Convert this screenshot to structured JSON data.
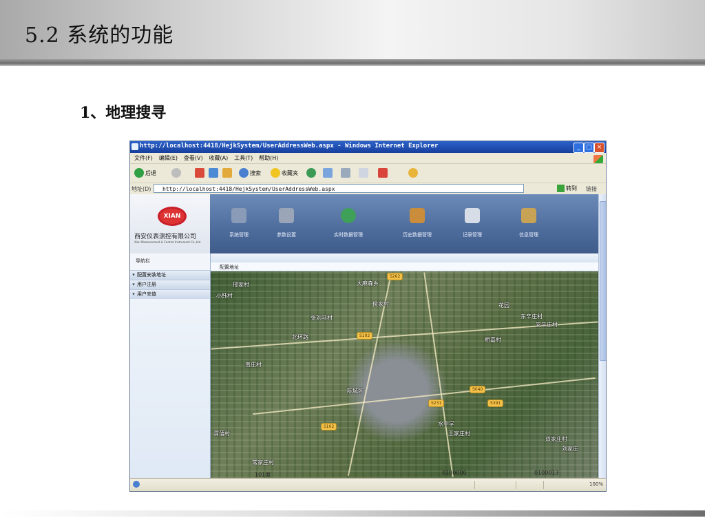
{
  "slide": {
    "title": "5.2   系统的功能",
    "subtitle": "1、地理搜寻"
  },
  "browser": {
    "window_title": "http://localhost:4418/HejkSystem/UserAddressWeb.aspx - Windows Internet Explorer",
    "menu": [
      "文件(F)",
      "编辑(E)",
      "查看(V)",
      "收藏(A)",
      "工具(T)",
      "帮助(H)"
    ],
    "toolbar": {
      "back": "后退",
      "search": "搜索",
      "favorites": "收藏夹"
    },
    "address_label": "地址(D)",
    "address_url": "http://localhost:4418/HejkSystem/UserAddressWeb.aspx",
    "go_label": "转到",
    "links_label": "链接"
  },
  "app": {
    "company_name": "西安仪表测控有限公司",
    "company_en": "Xian Measurement & Control Instrument Co.,Ltd",
    "logo_text": "XIAN",
    "nav": [
      {
        "label": "系统管理",
        "icon": "monitor-user-icon",
        "color": "#8a9bb8"
      },
      {
        "label": "参数设置",
        "icon": "settings-panel-icon",
        "color": "#9aa6b8"
      },
      {
        "label": "实时数据管理",
        "icon": "clock-icon",
        "color": "#3fa05a"
      },
      {
        "label": "历史数据管理",
        "icon": "notebook-pen-icon",
        "color": "#c98d3c"
      },
      {
        "label": "记录管理",
        "icon": "keys-icon",
        "color": "#d7dde6"
      },
      {
        "label": "信息管理",
        "icon": "toolbox-icon",
        "color": "#c8a255"
      }
    ],
    "sidebar_title": "导航栏",
    "sidebar_items": [
      "配置安装地址",
      "用户注册",
      "用户充值"
    ],
    "content_title": "配置地址",
    "map_labels": [
      "大麻森乡",
      "邢家村",
      "小韩村",
      "花园",
      "张刘马村",
      "北环路",
      "侯家村",
      "东辛庄村",
      "安辛庄村",
      "相嘉村",
      "陈城区",
      "南庄村",
      "水中学",
      "王家庄村",
      "双家庄村",
      "刘家庄",
      "渭蒲村",
      "常家庄村"
    ],
    "road_badges": [
      "S262",
      "S102",
      "S231",
      "S040",
      "S391",
      "S102"
    ],
    "coords": [
      "101度",
      "0100000",
      "0100013"
    ],
    "status_zoom": "100%"
  }
}
